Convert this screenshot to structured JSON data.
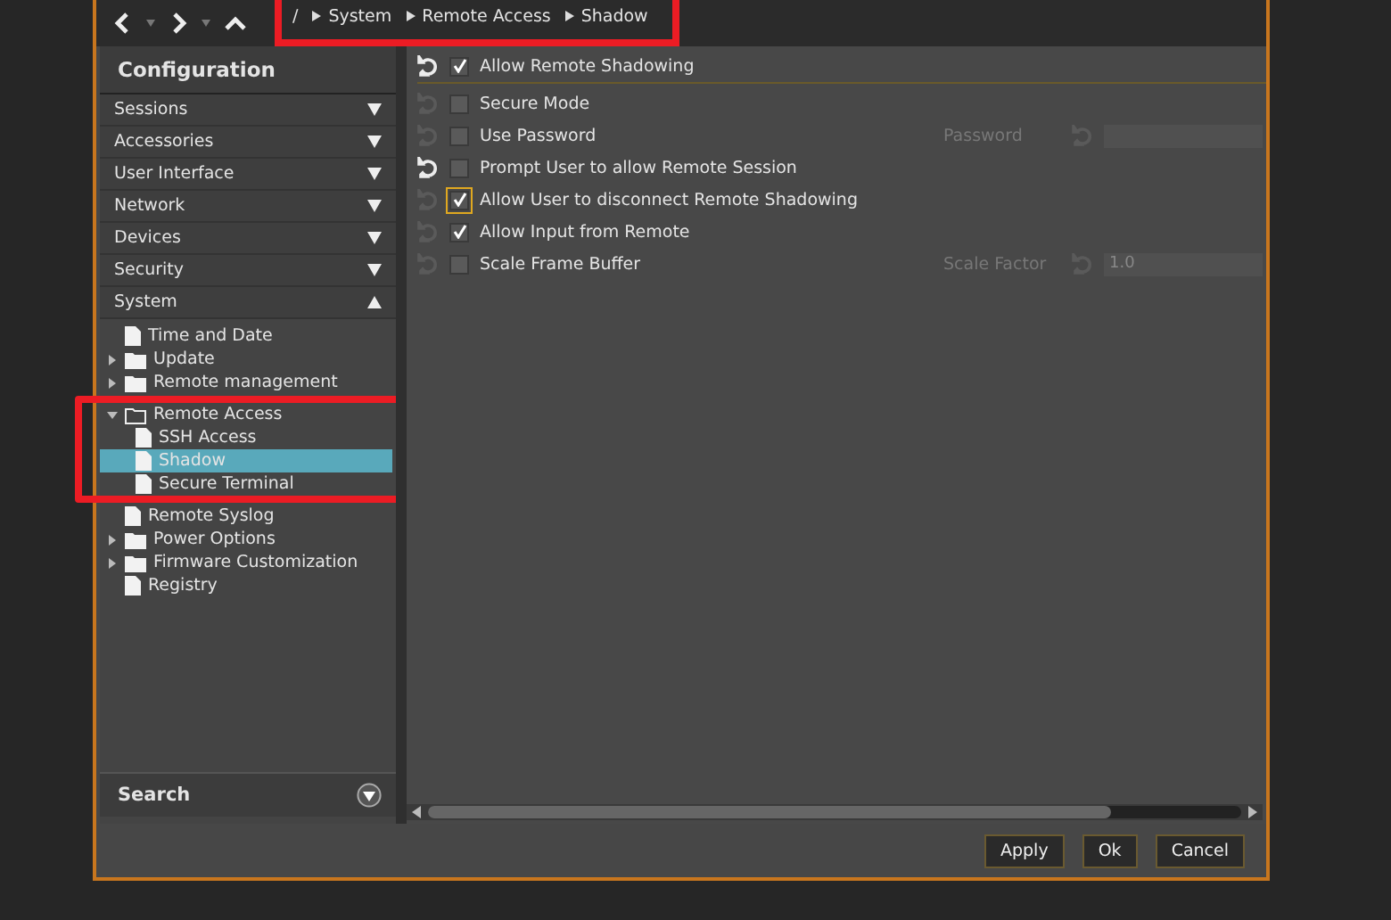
{
  "breadcrumb": {
    "root": "/",
    "items": [
      "System",
      "Remote Access",
      "Shadow"
    ],
    "highlighted": true
  },
  "sidebar": {
    "title": "Configuration",
    "sections": [
      {
        "label": "Sessions",
        "expanded": false
      },
      {
        "label": "Accessories",
        "expanded": false
      },
      {
        "label": "User Interface",
        "expanded": false
      },
      {
        "label": "Network",
        "expanded": false
      },
      {
        "label": "Devices",
        "expanded": false
      },
      {
        "label": "Security",
        "expanded": false
      },
      {
        "label": "System",
        "expanded": true
      }
    ],
    "tree": [
      {
        "label": "Time and Date",
        "kind": "file",
        "selected": false
      },
      {
        "label": "Update",
        "kind": "folder",
        "expanded": false,
        "selected": false
      },
      {
        "label": "Remote management",
        "kind": "folder",
        "expanded": false,
        "selected": false
      },
      {
        "label": "Remote Access",
        "kind": "folder",
        "expanded": true,
        "selected": false,
        "highlighted": true,
        "children": [
          {
            "label": "SSH Access",
            "kind": "file",
            "selected": false
          },
          {
            "label": "Shadow",
            "kind": "file",
            "selected": true
          },
          {
            "label": "Secure Terminal",
            "kind": "file",
            "selected": false
          }
        ]
      },
      {
        "label": "Remote Syslog",
        "kind": "file",
        "selected": false
      },
      {
        "label": "Power Options",
        "kind": "folder",
        "expanded": false,
        "selected": false
      },
      {
        "label": "Firmware Customization",
        "kind": "folder",
        "expanded": false,
        "selected": false
      },
      {
        "label": "Registry",
        "kind": "file",
        "selected": false
      }
    ],
    "search": {
      "label": "Search"
    }
  },
  "settings": [
    {
      "label": "Allow Remote Shadowing",
      "checked": true,
      "modified": true,
      "focused": false,
      "header": true
    },
    {
      "label": "Secure Mode",
      "checked": false,
      "modified": false,
      "focused": false,
      "header": false
    },
    {
      "label": "Use Password",
      "checked": false,
      "modified": false,
      "focused": false,
      "header": false,
      "field": {
        "label": "Password",
        "disabled": true
      }
    },
    {
      "label": "Prompt User to allow Remote Session",
      "checked": false,
      "modified": true,
      "focused": false,
      "header": false
    },
    {
      "label": "Allow User to disconnect Remote Shadowing",
      "checked": true,
      "modified": false,
      "focused": true,
      "header": false
    },
    {
      "label": "Allow Input from Remote",
      "checked": true,
      "modified": false,
      "focused": false,
      "header": false
    },
    {
      "label": "Scale Frame Buffer",
      "checked": false,
      "modified": false,
      "focused": false,
      "header": false,
      "field": {
        "label": "Scale Factor",
        "value": "1.0",
        "disabled": true
      }
    }
  ],
  "buttons": [
    "Apply",
    "Ok",
    "Cancel"
  ]
}
